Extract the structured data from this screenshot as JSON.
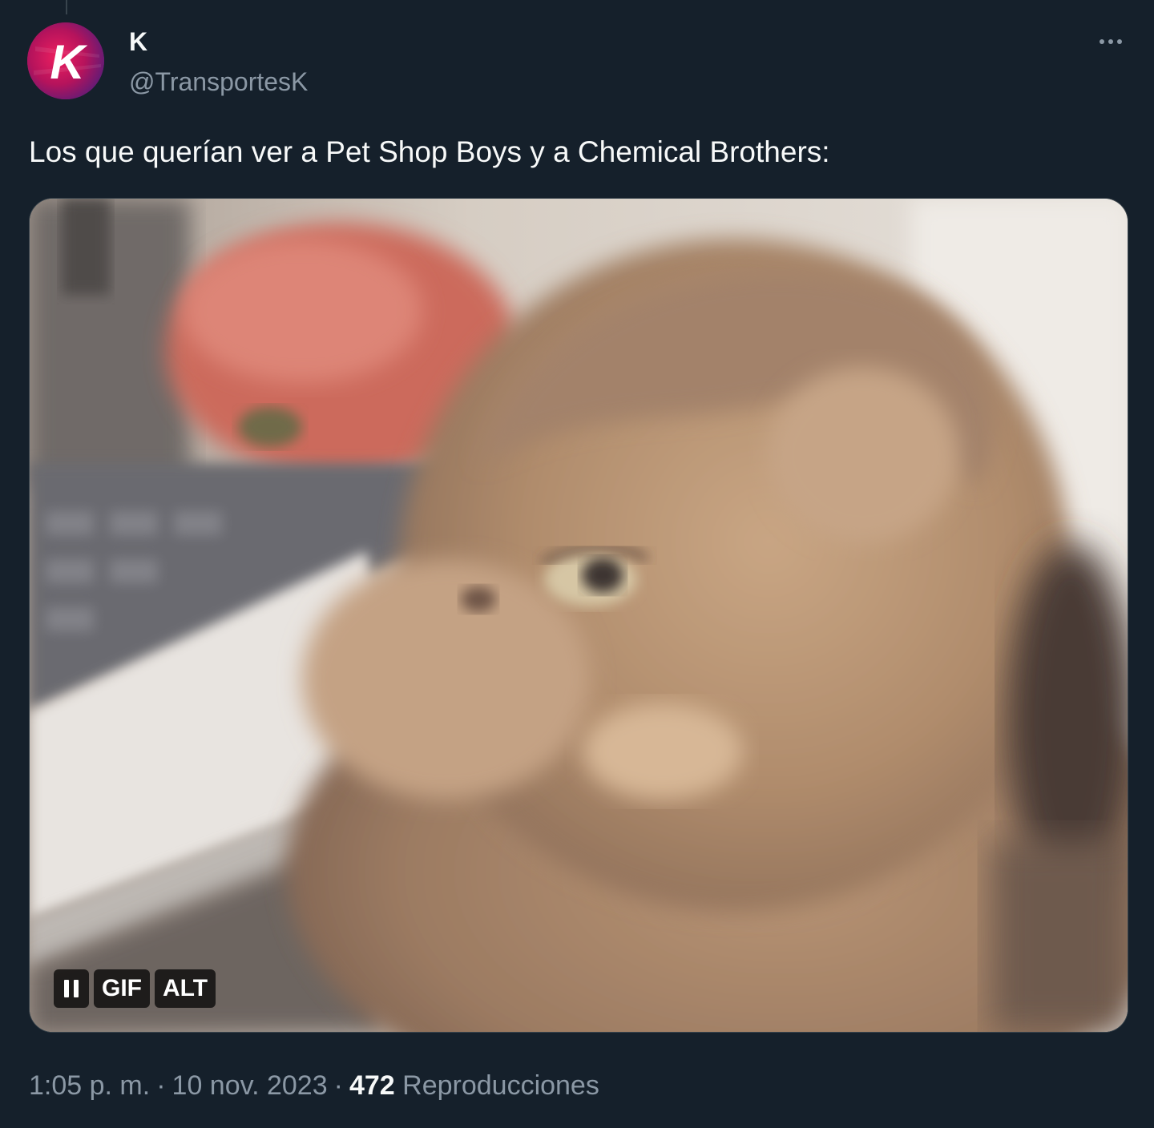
{
  "author": {
    "display_name": "K",
    "handle": "@TransportesK",
    "avatar_letter": "K",
    "avatar_icon": "k-logo-icon"
  },
  "tweet": {
    "text": "Los que querían ver a Pet Shop Boys y a Chemical Brothers:"
  },
  "media": {
    "type": "gif",
    "pause_icon": "pause-icon",
    "gif_label": "GIF",
    "alt_label": "ALT"
  },
  "meta": {
    "time": "1:05 p. m.",
    "separator": "·",
    "date": "10 nov. 2023",
    "views_count": "472",
    "views_label": "Reproducciones"
  },
  "colors": {
    "background": "#15202b",
    "primary_text": "#f7f9f9",
    "secondary_text": "#8b98a5",
    "border": "#38444d",
    "avatar_accent": "#e0185a"
  },
  "icons": {
    "more": "more-horizontal-icon"
  }
}
